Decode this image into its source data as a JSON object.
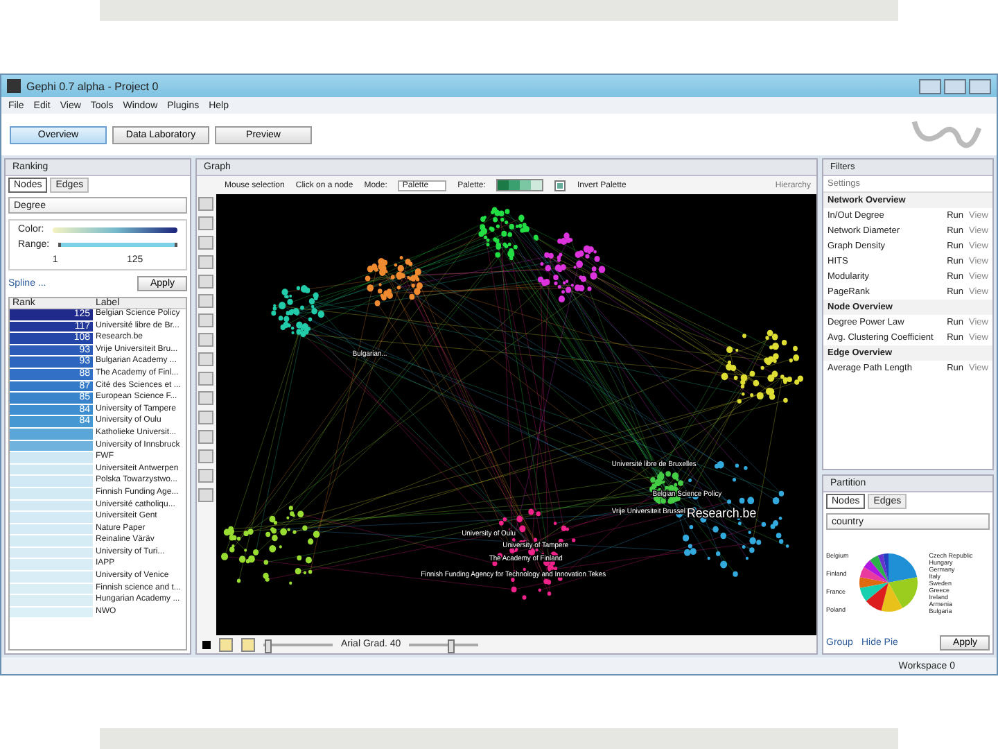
{
  "window": {
    "title": "Gephi 0.7 alpha - Project 0"
  },
  "menu": [
    "File",
    "Edit",
    "View",
    "Tools",
    "Window",
    "Plugins",
    "Help"
  ],
  "workspaces": [
    {
      "label": "Overview",
      "selected": true
    },
    {
      "label": "Data Laboratory",
      "selected": false
    },
    {
      "label": "Preview",
      "selected": false
    }
  ],
  "ranking": {
    "title": "Ranking",
    "tabs": [
      {
        "label": "Nodes",
        "selected": true
      },
      {
        "label": "Edges",
        "selected": false
      }
    ],
    "attribute": "Degree",
    "color_label": "Color:",
    "range_label": "Range:",
    "range_min": "1",
    "range_max": "125",
    "spline": "Spline ...",
    "apply": "Apply",
    "columns": [
      "Rank",
      "Label"
    ],
    "range": {
      "level": 1
    },
    "rows": [
      {
        "rank": "125",
        "label": "Belgian Science Policy",
        "color": "#1f2a8a"
      },
      {
        "rank": "117",
        "label": "Université libre de Br...",
        "color": "#21379a"
      },
      {
        "rank": "108",
        "label": "Research.be",
        "color": "#2446a8"
      },
      {
        "rank": "93",
        "label": "Vrije Universiteit Bru...",
        "color": "#2a5cb8"
      },
      {
        "rank": "93",
        "label": "Bulgarian Academy ...",
        "color": "#2d66bf"
      },
      {
        "rank": "88",
        "label": "The Academy of Finl...",
        "color": "#3170c4"
      },
      {
        "rank": "87",
        "label": "Cité des Sciences et ...",
        "color": "#357ac8"
      },
      {
        "rank": "85",
        "label": "European Science F...",
        "color": "#3a84cc"
      },
      {
        "rank": "84",
        "label": "University of Tampere",
        "color": "#3f8ecf"
      },
      {
        "rank": "84",
        "label": "University of Oulu",
        "color": "#4598d2"
      },
      {
        "label": "Katholieke Universit...",
        "color": "#5aa6d8"
      },
      {
        "label": "University of Innsbruck",
        "color": "#6fb2dd"
      },
      {
        "label": "FWF",
        "color": "#cfe8f3"
      },
      {
        "label": "Universiteit Antwerpen",
        "color": "#d0e9f3"
      },
      {
        "label": "Polska Towarzystwo...",
        "color": "#d1e9f4"
      },
      {
        "label": "Finnish Funding Age...",
        "color": "#d2eaf4"
      },
      {
        "label": "Université catholiqu...",
        "color": "#d3eaf4"
      },
      {
        "label": "Universiteit Gent",
        "color": "#d4ebf5"
      },
      {
        "label": "Nature Paper",
        "color": "#d5ebf5"
      },
      {
        "label": "Reinaline Väräv",
        "color": "#d6ecf5"
      },
      {
        "label": "University of Turi...",
        "color": "#d7ecf5"
      },
      {
        "label": "IAPP",
        "color": "#d8edf6"
      },
      {
        "label": "University of Venice",
        "color": "#d9edf6"
      },
      {
        "label": "Finnish science and t...",
        "color": "#daeef6"
      },
      {
        "label": "Hungarian Academy ...",
        "color": "#dbeef6"
      },
      {
        "label": "NWO",
        "color": "#dcf0f7"
      }
    ]
  },
  "graph": {
    "title": "Graph",
    "selection": "Mouse selection",
    "click": "Click on a node",
    "mode_label": "Mode:",
    "mode": "Palette",
    "palette_label": "Palette:",
    "invert": {
      "label": "Invert Palette",
      "checked": true
    },
    "hierarchy": "Hierarchy",
    "font": "Arial Grad. 40",
    "size_slider": {
      "level": 0.05
    },
    "font_slider": {
      "level": 0.6
    },
    "labels": [
      {
        "text": "Bulgarian..."
      },
      {
        "text": "Université libre de Bruxelles"
      },
      {
        "text": "Belgian Science Policy"
      },
      {
        "text": "Vrije Universiteit Brussel"
      },
      {
        "text": "Research.be"
      },
      {
        "text": "University of Oulu"
      },
      {
        "text": "University of Tampere"
      },
      {
        "text": "The Academy of Finland"
      },
      {
        "text": "Finnish Funding Agency for Technology and Innovation Tekes"
      }
    ]
  },
  "statistics": {
    "tabs": [
      {
        "label": "Filters"
      }
    ],
    "settings": "Settings",
    "sections": [
      {
        "title": "Network Overview",
        "items": [
          {
            "name": "In/Out Degree",
            "run": "Run",
            "view": "View"
          },
          {
            "name": "Network Diameter",
            "run": "Run",
            "view": "View"
          },
          {
            "name": "Graph Density",
            "run": "Run",
            "view": "View"
          },
          {
            "name": "HITS",
            "run": "Run",
            "view": "View"
          },
          {
            "name": "Modularity",
            "run": "Run",
            "view": "View"
          },
          {
            "name": "PageRank",
            "run": "Run",
            "view": "View"
          }
        ]
      },
      {
        "title": "Node Overview",
        "items": [
          {
            "name": "Degree Power Law",
            "run": "Run",
            "view": "View"
          },
          {
            "name": "Avg. Clustering Coefficient",
            "run": "Run",
            "view": "View"
          }
        ]
      },
      {
        "title": "Edge Overview",
        "items": [
          {
            "name": "Average Path Length",
            "run": "Run",
            "view": "View"
          }
        ]
      }
    ]
  },
  "partition": {
    "title": "Partition",
    "tabs": [
      {
        "label": "Nodes",
        "selected": true
      },
      {
        "label": "Edges",
        "selected": false
      }
    ],
    "attribute": "country",
    "left_labels": [
      "Belgium",
      "Finland",
      "France",
      "Poland"
    ],
    "right_labels": [
      "Czech Republic",
      "Hungary",
      "Germany",
      "Italy",
      "Sweden",
      "Greece",
      "Ireland",
      "Armenia",
      "Bulgaria"
    ],
    "group": "Group",
    "hide_pie": "Hide Pie",
    "apply": "Apply"
  },
  "status_bar": {
    "workspace": "Workspace 0"
  }
}
